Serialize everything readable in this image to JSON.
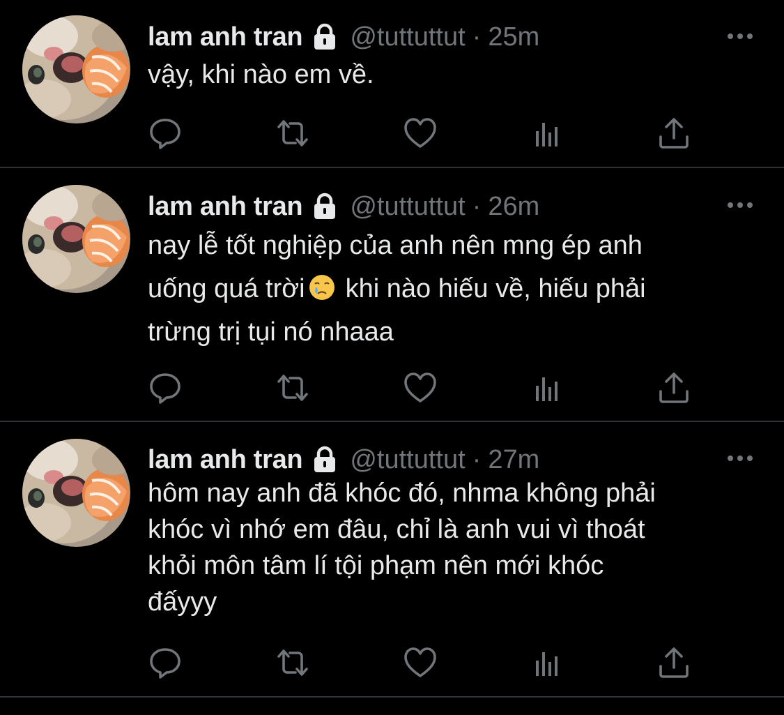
{
  "colors": {
    "background": "#000000",
    "text_primary": "#e7e9ea",
    "text_secondary": "#71767b",
    "divider": "#2f3336"
  },
  "icons": {
    "verified_lock": "lock-icon",
    "more": "more-horizontal-icon",
    "reply": "reply-icon",
    "retweet": "retweet-icon",
    "like": "heart-icon",
    "analytics": "analytics-icon",
    "share": "share-icon"
  },
  "tweets": [
    {
      "display_name": "lam anh tran",
      "handle": "@tuttuttut",
      "separator": "·",
      "time": "25m",
      "lines": [
        "vậy, khi nào em về."
      ]
    },
    {
      "display_name": "lam anh tran",
      "handle": "@tuttuttut",
      "separator": "·",
      "time": "26m",
      "lines": [
        "nay lễ tốt nghiệp của anh nên mng ép anh",
        "uống quá trời",
        "khi nào hiếu về, hiếu phải",
        "trừng trị tụi nó nhaaa"
      ],
      "emoji": "crying-face-emoji"
    },
    {
      "display_name": "lam anh tran",
      "handle": "@tuttuttut",
      "separator": "·",
      "time": "27m",
      "lines": [
        "hôm nay anh đã khóc đó, nhma không phải",
        "khóc vì nhớ em đâu, chỉ là anh vui vì thoát",
        "khỏi môn tâm lí tội phạm nên mới khóc",
        "đấyyy"
      ]
    }
  ]
}
